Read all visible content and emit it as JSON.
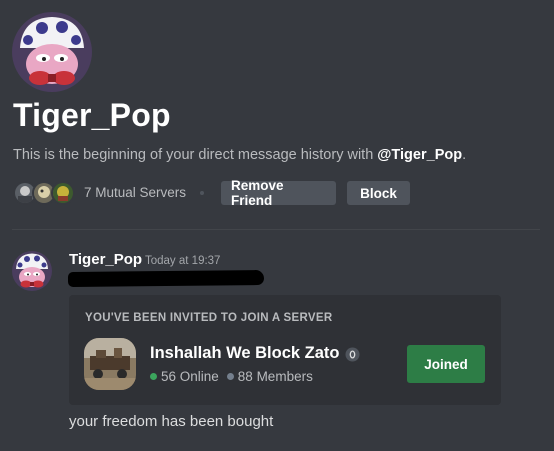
{
  "profile": {
    "username": "Tiger_Pop",
    "intro_prefix": "This is the beginning of your direct message history with ",
    "intro_mention": "@Tiger_Pop",
    "intro_suffix": ".",
    "avatar_icon": "mario-mushroom-pepe-avatar"
  },
  "mutual": {
    "label": "7 Mutual Servers",
    "server_icons": [
      "server-icon-1",
      "server-icon-2",
      "server-icon-3"
    ]
  },
  "actions": {
    "remove_friend": "Remove Friend",
    "block": "Block"
  },
  "message": {
    "author": "Tiger_Pop",
    "timestamp": "Today at 19:37",
    "text": "your freedom has been bought"
  },
  "invite": {
    "header": "YOU'VE BEEN INVITED TO JOIN A SERVER",
    "server_name": "Inshallah We Block Zato",
    "online": "56 Online",
    "members": "88 Members",
    "joined_label": "Joined"
  },
  "colors": {
    "background": "#36393f",
    "card": "#2f3136",
    "button": "#4f545c",
    "joined": "#2d7d46",
    "online": "#3ba55d",
    "offline": "#747f8d"
  }
}
